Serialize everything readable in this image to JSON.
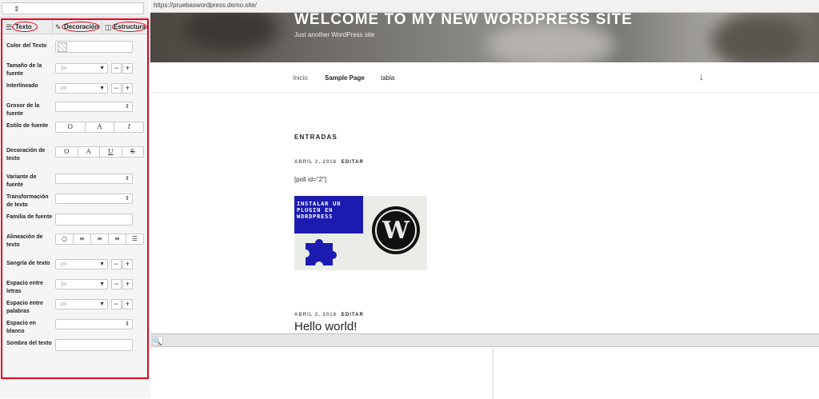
{
  "toolbar": {
    "check_icon": "checkmark-icon"
  },
  "panel": {
    "tabs": [
      {
        "label": "Texto",
        "icon": "menu-icon"
      },
      {
        "label": "Decoración",
        "icon": "dropper-icon"
      },
      {
        "label": "Estructura",
        "icon": "columns-icon"
      }
    ],
    "rows": {
      "color": "Color del Texto",
      "size": "Tamaño de la fuente",
      "line": "Interlineado",
      "weight": "Grosor de la fuente",
      "style": "Estilo de fuente",
      "decoration": "Decoración de texto",
      "variant": "Variante de fuente",
      "transform": "Transformación de texto",
      "family": "Familia de fuente",
      "align": "Alineación de texto",
      "indent": "Sangría de texto",
      "letter": "Espacio entre letras",
      "word": "Espacio entre palabras",
      "white": "Espacio en blanco",
      "shadow": "Sombra del texto"
    },
    "unit_placeholder": "px",
    "minus": "−",
    "plus": "+",
    "style_buttons": [
      "O",
      "A",
      "I"
    ],
    "decoration_buttons": [
      "O",
      "A",
      "U",
      "S"
    ]
  },
  "browser": {
    "url": "https://pruebaswordpress.demo.site/",
    "site_title": "WELCOME TO MY NEW WORDPRESS SITE",
    "tagline": "Just another WordPress site",
    "nav": [
      "Inicio",
      "Sample Page",
      "tabla"
    ],
    "section_heading": "ENTRADAS",
    "post1": {
      "date": "ABRIL 2, 2018",
      "edit": "EDITAR",
      "shortcode": "[poll id=\"2\"]"
    },
    "promo_text": "INSTALAR UN PLUGIN EN WORDPRESS",
    "post2": {
      "date": "ABRIL 2, 2018",
      "edit": "EDITAR",
      "title": "Hello world!"
    }
  },
  "colors": {
    "highlight": "#e2001a",
    "promo_blue": "#1b1bb0"
  }
}
